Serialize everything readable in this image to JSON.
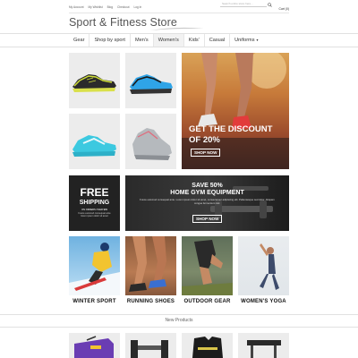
{
  "topbar": {
    "links": [
      "My Account",
      "My Wishlist",
      "Blog",
      "Checkout",
      "Log In"
    ],
    "search_placeholder": "Search entire store here...",
    "cart_label": "Cart (0)"
  },
  "header": {
    "logo_text": "Sport & Fitness Store"
  },
  "nav": {
    "items": [
      {
        "label": "Gear"
      },
      {
        "label": "Shop by sport"
      },
      {
        "label": "Men's"
      },
      {
        "label": "Women's"
      },
      {
        "label": "Kids'"
      },
      {
        "label": "Casual"
      },
      {
        "label": "Uniforms"
      }
    ]
  },
  "banners": {
    "discount": {
      "line1": "GET THE DISCOUNT",
      "line2": "OF 20%",
      "button": "SHOP NOW"
    },
    "shipping": {
      "line1": "FREE",
      "line2": "SHIPPING",
      "subtext_small": "ON ORDERS OVER $99",
      "subtext": "Fusce euismod consequat ante lorem ipsum dolor sit amet"
    },
    "homegym": {
      "line1": "SAVE 50%",
      "line2": "HOME GYM EQUIPMENT",
      "subtext": "Fusce euismod consequat ante. Lorem ipsum dolor sit amet, consectetuer adipiscing elit. Pellentesque sed dolor. Aliquam congue fermentum nisl.",
      "button": "SHOP NOW"
    }
  },
  "categories": [
    {
      "label": "WINTER SPORT"
    },
    {
      "label": "RUNNING SHOES"
    },
    {
      "label": "OUTDOOR GEAR"
    },
    {
      "label": "WOMEN'S YOGA"
    }
  ],
  "new_products": {
    "title": "New Products"
  },
  "colors": {
    "brand": "#555555",
    "accent_red": "#e04a3f",
    "dark_tile": "#222222"
  }
}
